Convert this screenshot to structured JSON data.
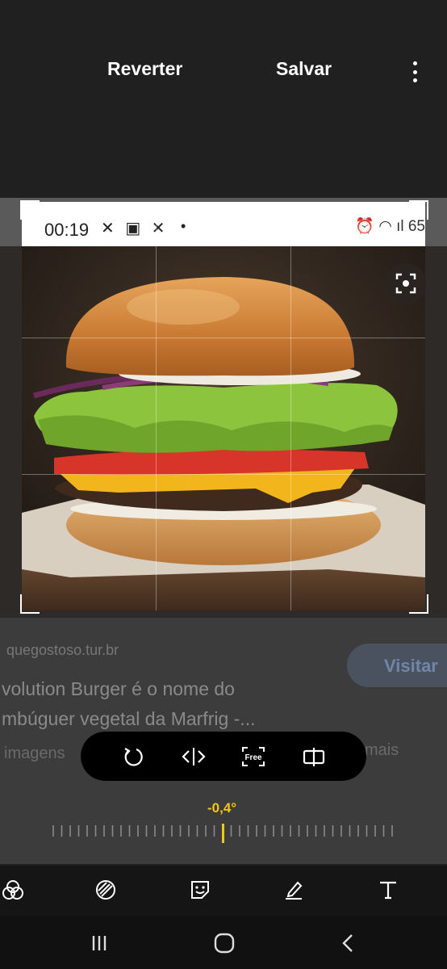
{
  "header": {
    "revert_label": "Reverter",
    "save_label": "Salvar",
    "more_icon": "more-vert-icon"
  },
  "screenshot_status": {
    "time": "00:19",
    "left_icons": "✕ ▣ ✕",
    "dot": "•",
    "right_icons": "⏰ ◠ ıl 65"
  },
  "background_page": {
    "source": "quegostoso.tur.br",
    "visit_label": "Visitar",
    "title_line1": "volution Burger é o nome do",
    "title_line2": "mbúguer vegetal da Marfrig -...",
    "more_images": "imagens",
    "more_suffix": "mais"
  },
  "transform_toolbar": {
    "rotate_icon": "rotate-icon",
    "flip_icon": "flip-horizontal-icon",
    "free_label": "Free",
    "aspect_icon": "aspect-ratio-icon"
  },
  "rotation": {
    "angle": "-0,4°",
    "value": -0.4
  },
  "edit_toolbar": [
    "filters-icon",
    "adjust-icon",
    "sticker-icon",
    "draw-icon",
    "text-icon"
  ],
  "colors": {
    "accent": "#f5c518",
    "background": "#202020",
    "toolbar": "#000000"
  }
}
